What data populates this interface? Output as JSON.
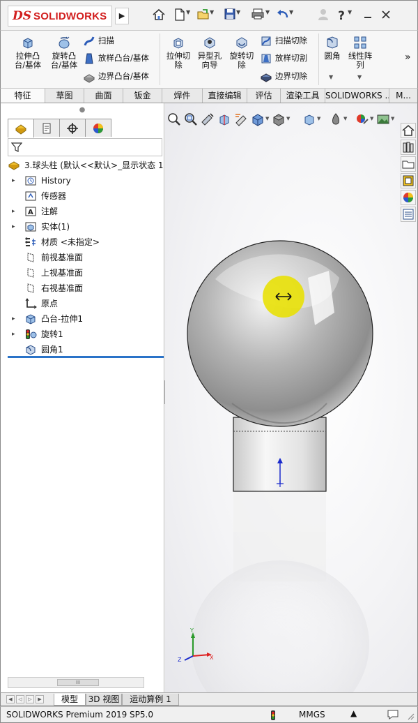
{
  "app": {
    "logo_ds": "DS",
    "logo_text": "SOLIDWORKS"
  },
  "quick_access": [
    "home-icon",
    "new-document-icon",
    "open-icon",
    "save-icon",
    "print-icon",
    "undo-icon",
    "user-icon",
    "help-icon",
    "minimize-icon",
    "close-icon"
  ],
  "ribbon": {
    "extrude_boss": "拉伸凸\n台/基体",
    "revolve_boss": "旋转凸\n台/基体",
    "sweep": "扫描",
    "loft_boss": "放样凸台/基体",
    "boundary_boss": "边界凸台/基体",
    "extrude_cut": "拉伸切\n除",
    "hole_wizard": "异型孔\n向导",
    "revolve_cut": "旋转切\n除",
    "swept_cut": "扫描切除",
    "lofted_cut": "放样切割",
    "boundary_cut": "边界切除",
    "fillet": "圆角",
    "linear_pattern": "线性阵\n列",
    "more": "»"
  },
  "command_tabs": [
    "特征",
    "草图",
    "曲面",
    "钣金",
    "焊件",
    "直接编辑",
    "评估",
    "渲染工具",
    "SOLIDWORKS ...",
    "M..."
  ],
  "active_command_tab": 0,
  "tree": {
    "root": "3.球头柱  (默认<<默认>_显示状态 1>",
    "items": [
      {
        "label": "History",
        "expandable": true,
        "icon": "history-icon"
      },
      {
        "label": "传感器",
        "expandable": false,
        "icon": "sensor-icon"
      },
      {
        "label": "注解",
        "expandable": true,
        "icon": "annotation-icon"
      },
      {
        "label": "实体(1)",
        "expandable": true,
        "icon": "solid-bodies-icon"
      },
      {
        "label": "材质 <未指定>",
        "expandable": false,
        "icon": "material-icon"
      },
      {
        "label": "前视基准面",
        "expandable": false,
        "icon": "plane-icon"
      },
      {
        "label": "上视基准面",
        "expandable": false,
        "icon": "plane-icon"
      },
      {
        "label": "右视基准面",
        "expandable": false,
        "icon": "plane-icon"
      },
      {
        "label": "原点",
        "expandable": false,
        "icon": "origin-icon"
      },
      {
        "label": "凸台-拉伸1",
        "expandable": true,
        "icon": "extrude-feature-icon"
      },
      {
        "label": "旋转1",
        "expandable": true,
        "icon": "revolve-feature-icon"
      },
      {
        "label": "圆角1",
        "expandable": false,
        "icon": "fillet-feature-icon"
      }
    ]
  },
  "bottom_tabs": [
    "模型",
    "3D 视图",
    "运动算例 1"
  ],
  "active_bottom_tab": 0,
  "status": {
    "product": "SOLIDWORKS Premium 2019 SP5.0",
    "units": "MMGS"
  },
  "colors": {
    "brand_red": "#d21f1f",
    "rollback_bar": "#2a73c8",
    "cursor_highlight": "#e8e000",
    "part_gray": "#9a9a9a"
  }
}
